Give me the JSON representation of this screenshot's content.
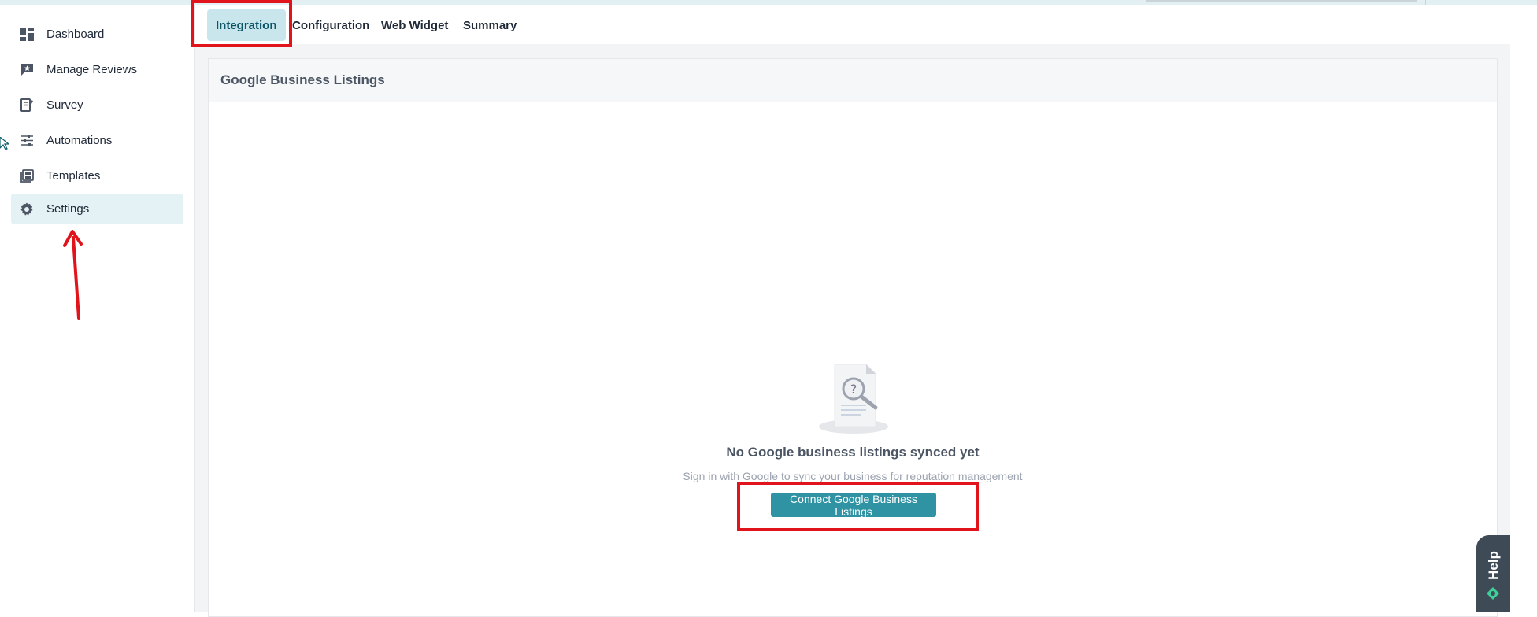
{
  "sidebar": {
    "items": [
      {
        "label": "Dashboard",
        "icon": "dashboard-icon",
        "active": false
      },
      {
        "label": "Manage Reviews",
        "icon": "reviews-icon",
        "active": false
      },
      {
        "label": "Survey",
        "icon": "survey-icon",
        "active": false
      },
      {
        "label": "Automations",
        "icon": "sliders-icon",
        "active": false
      },
      {
        "label": "Templates",
        "icon": "templates-icon",
        "active": false
      },
      {
        "label": "Settings",
        "icon": "gear-icon",
        "active": true
      }
    ]
  },
  "tabs": [
    {
      "label": "Integration",
      "active": true
    },
    {
      "label": "Configuration",
      "active": false
    },
    {
      "label": "Web Widget",
      "active": false
    },
    {
      "label": "Summary",
      "active": false
    }
  ],
  "panel": {
    "title": "Google Business Listings",
    "empty_title": "No Google business listings synced yet",
    "empty_subtitle": "Sign in with Google to sync your business for reputation management",
    "connect_label": "Connect Google Business Listings"
  },
  "help": {
    "label": "Help"
  },
  "colors": {
    "accent": "#2f93a3",
    "active_tab_bg": "#c9e6ec",
    "active_nav_bg": "#e4f2f5",
    "annotation": "#e0141a"
  }
}
